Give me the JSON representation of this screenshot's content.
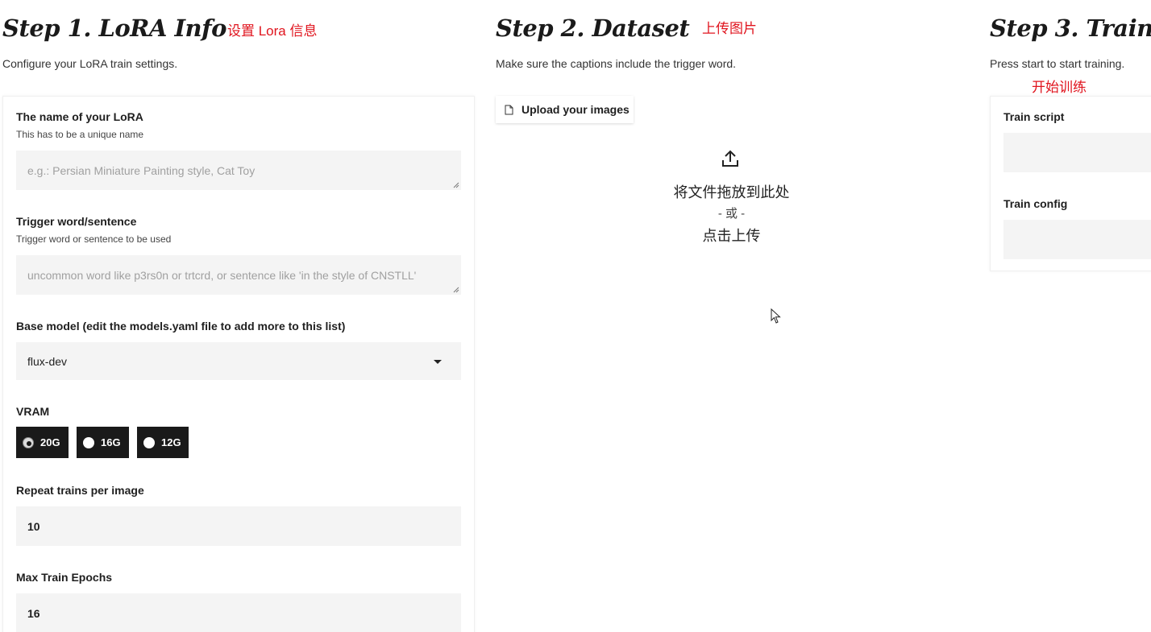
{
  "step1": {
    "title": "Step 1. LoRA Info",
    "annotation": "设置 Lora 信息",
    "description": "Configure your LoRA train settings.",
    "lora_name": {
      "label": "The name of your LoRA",
      "help": "This has to be a unique name",
      "placeholder": "e.g.: Persian Miniature Painting style, Cat Toy",
      "value": ""
    },
    "trigger": {
      "label": "Trigger word/sentence",
      "help": "Trigger word or sentence to be used",
      "placeholder": "uncommon word like p3rs0n or trtcrd, or sentence like 'in the style of CNSTLL'",
      "value": ""
    },
    "base_model": {
      "label": "Base model (edit the models.yaml file to add more to this list)",
      "value": "flux-dev"
    },
    "vram": {
      "label": "VRAM",
      "options": [
        "20G",
        "16G",
        "12G"
      ],
      "selected": "20G"
    },
    "repeats": {
      "label": "Repeat trains per image",
      "value": "10"
    },
    "epochs": {
      "label": "Max Train Epochs",
      "value": "16"
    }
  },
  "step2": {
    "title": "Step 2. Dataset",
    "annotation": "上传图片",
    "description": "Make sure the captions include the trigger word.",
    "upload_button": "Upload your images",
    "drop_text": "将文件拖放到此处",
    "or_text": "- 或 -",
    "click_text": "点击上传"
  },
  "step3": {
    "title": "Step 3. Train",
    "annotation": "开始训练",
    "description": "Press start to start training.",
    "train_script_label": "Train script",
    "train_config_label": "Train config"
  }
}
